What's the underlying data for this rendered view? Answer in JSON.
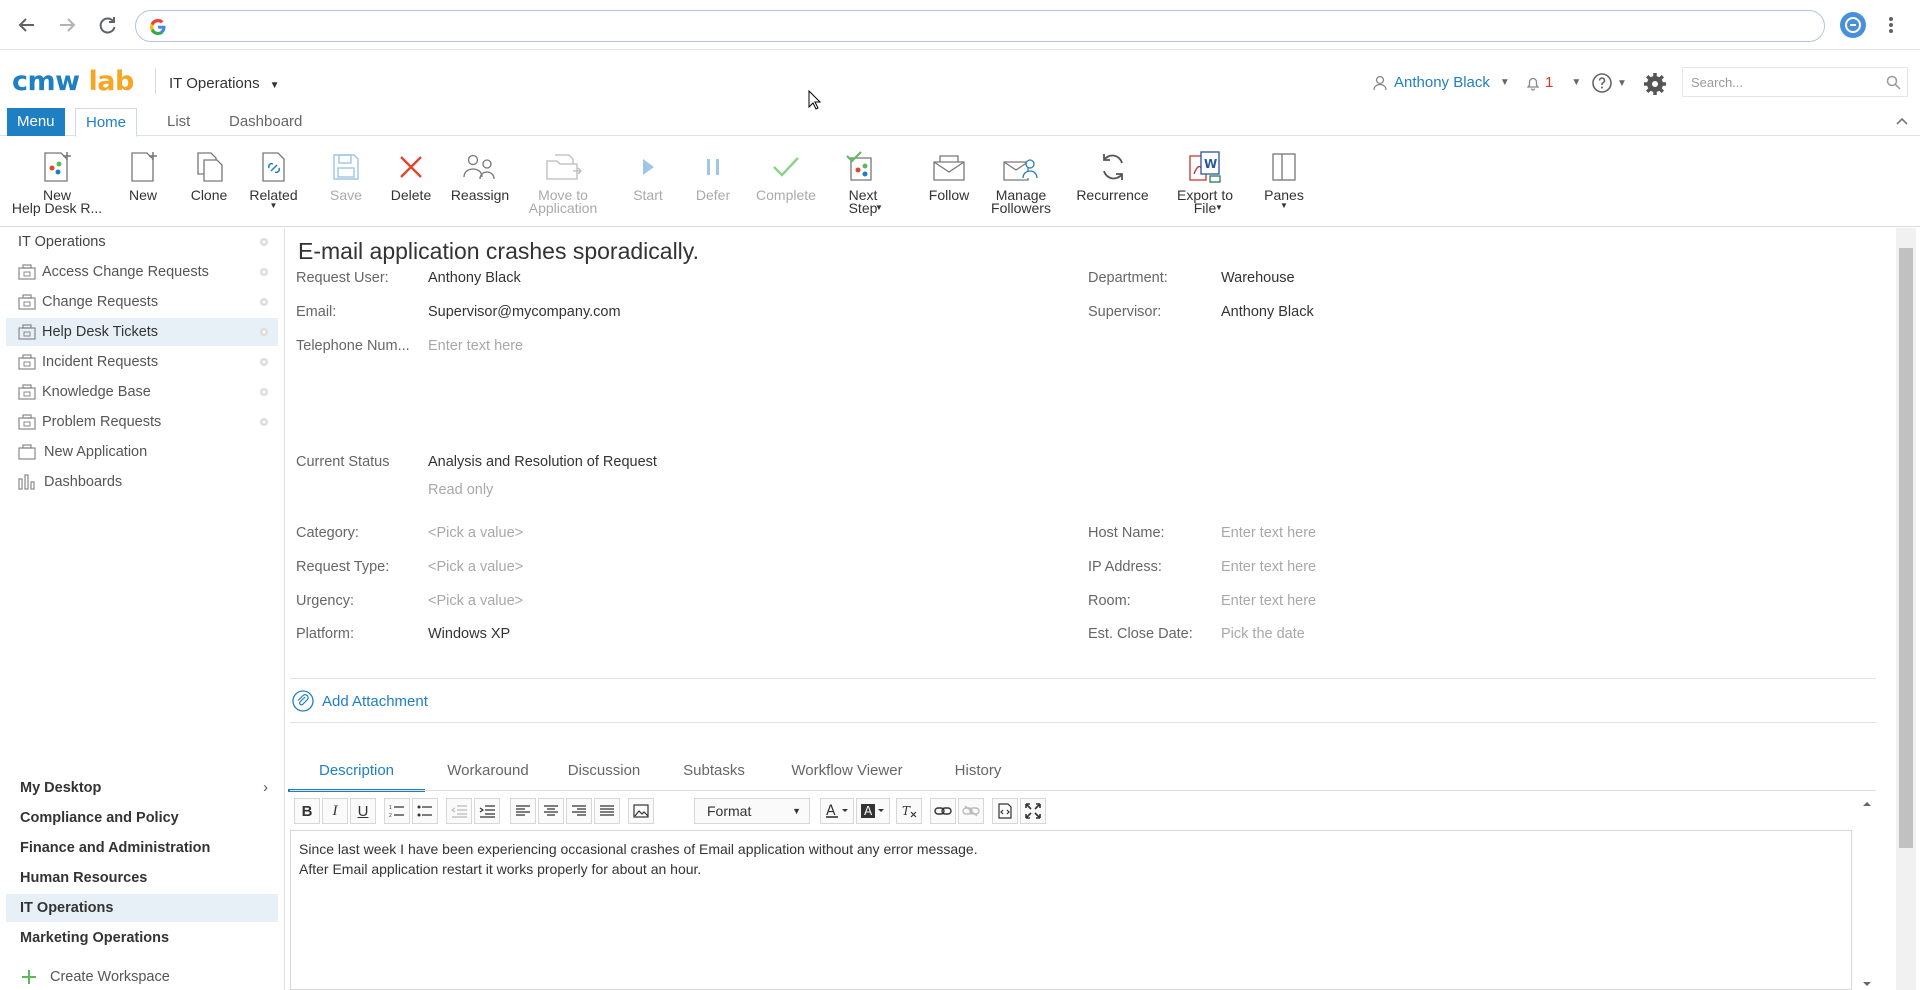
{
  "browser": {
    "url": ""
  },
  "header": {
    "logo_part1": "cmw",
    "logo_part2": "lab",
    "workspace": "IT Operations",
    "user": "Anthony Black",
    "notification_count": "1",
    "search_placeholder": "Search..."
  },
  "tabs": {
    "menu": "Menu",
    "home": "Home",
    "list": "List",
    "dashboard": "Dashboard"
  },
  "ribbon": {
    "new_help_desk_1": "New",
    "new_help_desk_2": "Help Desk R...",
    "new": "New",
    "clone": "Clone",
    "related": "Related",
    "save": "Save",
    "delete": "Delete",
    "reassign": "Reassign",
    "move_1": "Move to",
    "move_2": "Application",
    "start": "Start",
    "defer": "Defer",
    "complete": "Complete",
    "next_step_1": "Next",
    "next_step_2": "Step",
    "follow": "Follow",
    "manage_1": "Manage",
    "manage_2": "Followers",
    "recurrence": "Recurrence",
    "export_1": "Export to",
    "export_2": "File",
    "panes": "Panes"
  },
  "sidebar": {
    "root": "IT Operations",
    "items": [
      "Access Change Requests",
      "Change Requests",
      "Help Desk Tickets",
      "Incident Requests",
      "Knowledge Base",
      "Problem Requests",
      "New Application",
      "Dashboards"
    ],
    "workspaces": [
      "My Desktop",
      "Compliance and Policy",
      "Finance and Administration",
      "Human Resources",
      "IT Operations",
      "Marketing Operations"
    ],
    "create_workspace": "Create Workspace"
  },
  "record": {
    "title": "E-mail application crashes sporadically.",
    "labels": {
      "request_user": "Request User:",
      "email": "Email:",
      "telephone": "Telephone Num...",
      "department": "Department:",
      "supervisor": "Supervisor:",
      "current_status": "Current Status",
      "category": "Category:",
      "request_type": "Request Type:",
      "urgency": "Urgency:",
      "platform": "Platform:",
      "host_name": "Host Name:",
      "ip_address": "IP Address:",
      "room": "Room:",
      "est_close_date": "Est. Close Date:"
    },
    "values": {
      "request_user": "Anthony Black",
      "email": "Supervisor@mycompany.com",
      "telephone": "Enter text here",
      "department": "Warehouse",
      "supervisor": "Anthony Black",
      "current_status": "Analysis and Resolution of Request",
      "status_note": "Read only",
      "category": "<Pick a value>",
      "request_type": "<Pick a value>",
      "urgency": "<Pick a value>",
      "platform": "Windows XP",
      "host_name": "Enter text here",
      "ip_address": "Enter text here",
      "room": "Enter text here",
      "est_close_date": "Pick the date"
    },
    "add_attachment": "Add Attachment"
  },
  "subtabs": [
    "Description",
    "Workaround",
    "Discussion",
    "Subtasks",
    "Workflow Viewer",
    "History"
  ],
  "editor": {
    "format_label": "Format",
    "bold": "B",
    "italic": "I",
    "underline": "U",
    "line1": "Since last week I have been experiencing occasional crashes of Email application without any error message.",
    "line2": "After Email application restart it works properly for about an hour."
  },
  "colors": {
    "accent": "#1f7fc3",
    "logo_orange": "#f5a623",
    "delete_red": "#e0482f",
    "complete_green": "#5cb85c"
  }
}
